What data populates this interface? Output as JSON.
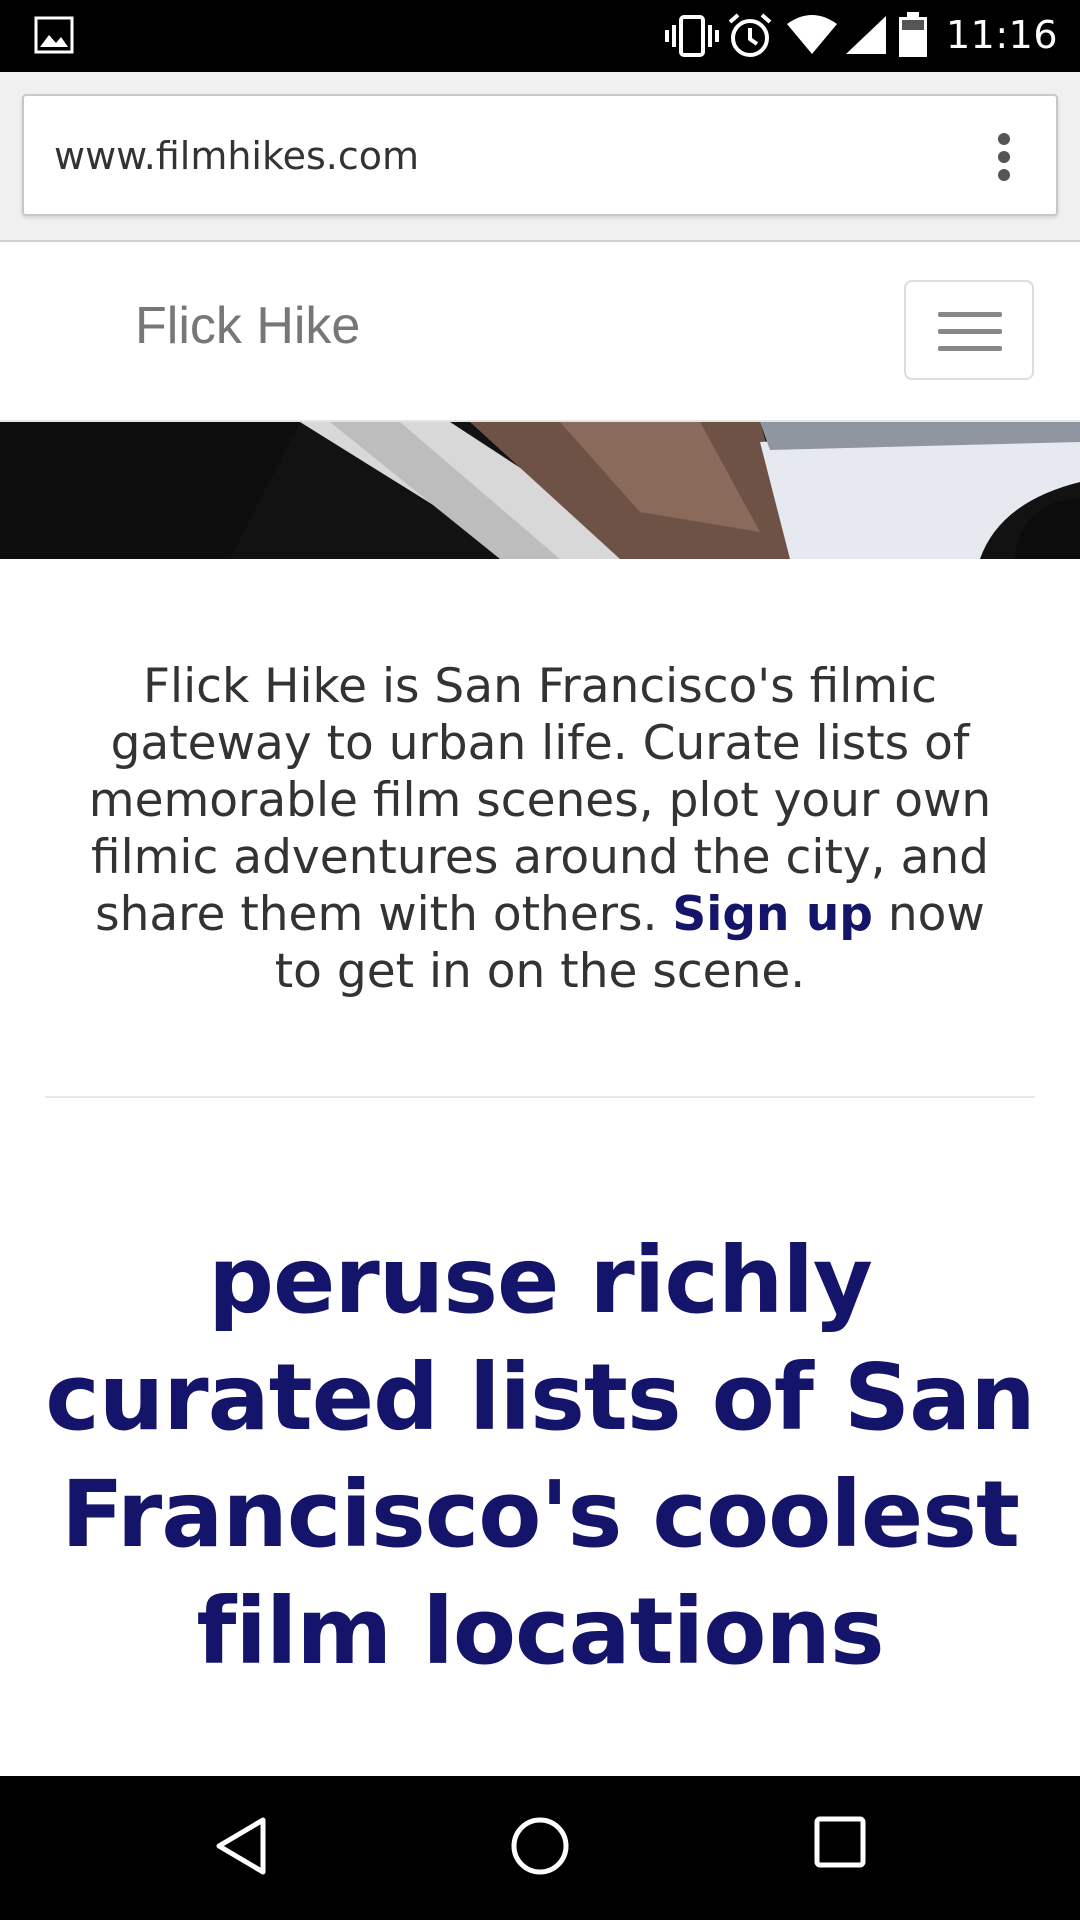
{
  "status_bar": {
    "time": "11:16",
    "icons": [
      "gallery-icon",
      "vibrate-icon",
      "alarm-icon",
      "wifi-icon",
      "cell-signal-icon",
      "battery-icon"
    ]
  },
  "browser": {
    "url": "www.filmhikes.com",
    "menu_icon": "overflow-menu-icon"
  },
  "site": {
    "brand": "Flick Hike",
    "nav_toggle_icon": "hamburger-icon",
    "intro_text": "Flick Hike is San Francisco's filmic gateway to urban life. Curate lists of memorable film scenes, plot your own filmic adventures around the city, and share them with others. ",
    "signup_link": "Sign up",
    "intro_tail": " now to get in on the scene.",
    "headline": "peruse richly curated lists of San Francisco's coolest film locations"
  },
  "colors": {
    "accent": "#14146b",
    "body_text": "#333333",
    "brand_text": "#777777"
  },
  "android_nav": {
    "icons": [
      "back-icon",
      "home-icon",
      "recents-icon"
    ]
  }
}
